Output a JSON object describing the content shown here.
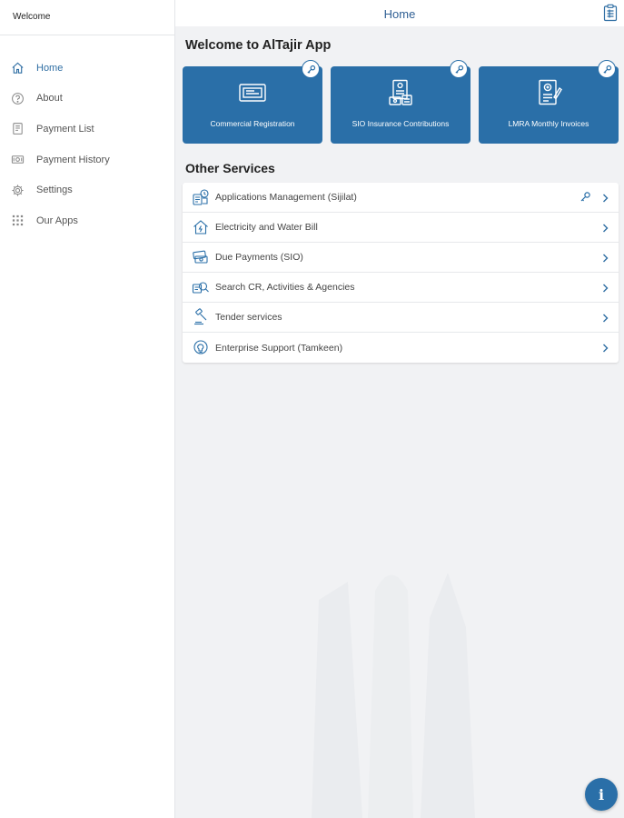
{
  "sidebar": {
    "header": "Welcome",
    "items": [
      {
        "label": "Home",
        "icon": "home-icon",
        "active": true
      },
      {
        "label": "About",
        "icon": "question-circle-icon"
      },
      {
        "label": "Payment List",
        "icon": "document-list-icon"
      },
      {
        "label": "Payment History",
        "icon": "money-icon"
      },
      {
        "label": "Settings",
        "icon": "gear-icon"
      },
      {
        "label": "Our Apps",
        "icon": "grid-icon"
      }
    ]
  },
  "topbar": {
    "title": "Home",
    "action_icon": "clipboard-icon"
  },
  "main": {
    "welcome_heading": "Welcome to AlTajir App",
    "tiles": [
      {
        "label": "Commercial Registration",
        "icon": "registration-card-icon",
        "badge_icon": "key-icon"
      },
      {
        "label": "SIO Insurance Contributions",
        "icon": "insurance-document-icon",
        "badge_icon": "key-icon"
      },
      {
        "label": "LMRA Monthly Invoices",
        "icon": "invoice-icon",
        "badge_icon": "key-icon"
      }
    ],
    "other_heading": "Other Services",
    "services": [
      {
        "label": "Applications Management (Sijilat)",
        "icon": "applications-icon",
        "has_key": true
      },
      {
        "label": "Electricity and Water Bill",
        "icon": "house-utility-icon"
      },
      {
        "label": "Due Payments (SIO)",
        "icon": "payments-icon"
      },
      {
        "label": "Search CR, Activities & Agencies",
        "icon": "search-documents-icon"
      },
      {
        "label": "Tender services",
        "icon": "gavel-icon"
      },
      {
        "label": "Enterprise Support (Tamkeen)",
        "icon": "lightbulb-icon"
      }
    ]
  },
  "fab": {
    "label": "i",
    "icon": "info-icon"
  },
  "colors": {
    "primary": "#2a6fa8",
    "accent_text": "#2f5f94",
    "background": "#f1f2f4"
  }
}
